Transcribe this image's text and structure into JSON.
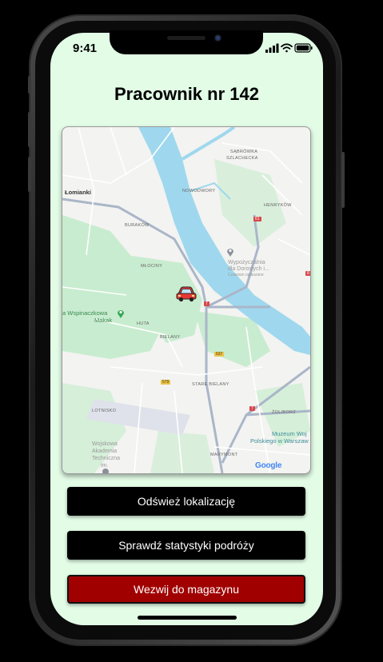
{
  "status_bar": {
    "time": "9:41"
  },
  "header": {
    "title": "Pracownik nr 142"
  },
  "map": {
    "labels": {
      "lomianki": "Łomianki",
      "sadrowka": "SĄBRÓWKA",
      "szlachecka": "SZLACHECKA",
      "nowodwory": "NOWODWORY",
      "henrykow": "HENRYKÓW",
      "buraków": "BURAKÓW",
      "mlociny": "MŁOCINY",
      "huta": "HUTA",
      "bielany": "BIELANY",
      "stare_bielany": "STARE BIELANY",
      "lotnisko": "LOTNISKO",
      "zoliborz": "ŻOLIBORZ",
      "marymont": "MARYMONT",
      "poi_rental_1": "Wypożyczalnia",
      "poi_rental_2": "dla Dorosłych i...",
      "poi_rental_3": "Czasowo ogłaszane",
      "poi_park_1": "a Wspinaczkowa",
      "poi_park_2": "Makak",
      "poi_museum_1": "Muzeum Woj",
      "poi_museum_2": "Polskiego w Warszaw",
      "poi_academy_1": "Wojskowa",
      "poi_academy_2": "Akademia",
      "poi_academy_3": "Techniczna",
      "poi_academy_4": "im.",
      "google": "Google",
      "road_61": "61",
      "road_7": "7",
      "road_s7": "7",
      "road_637": "637",
      "road_579": "579",
      "road_r8": "8"
    },
    "marker": "vehicle-icon"
  },
  "actions": {
    "refresh": "Odśwież lokalizację",
    "stats": "Sprawdź statystyki podróży",
    "summon": "Wezwij do magazynu"
  },
  "colors": {
    "screen_bg": "#e2fce6",
    "primary_button": "#000000",
    "danger_button": "#a00000",
    "river": "#9fd8ee",
    "park": "#c8eccf"
  }
}
